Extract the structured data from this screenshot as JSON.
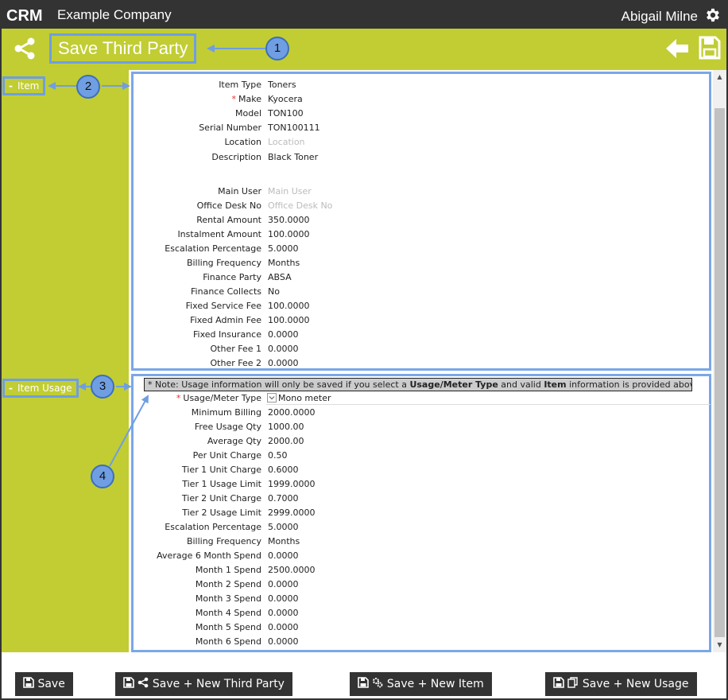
{
  "topbar": {
    "logo_text": "CRM",
    "company": "Example Company",
    "user": "Abigail Milne"
  },
  "header": {
    "title": "Save Third Party"
  },
  "sections": {
    "item": "Item",
    "usage": "Item Usage"
  },
  "annotations": [
    "1",
    "2",
    "3",
    "4"
  ],
  "item_fields": [
    {
      "label": "Item Type",
      "value": "Toners"
    },
    {
      "label": "Make",
      "value": "Kyocera",
      "required": true
    },
    {
      "label": "Model",
      "value": "TON100"
    },
    {
      "label": "Serial Number",
      "value": "TON100111"
    },
    {
      "label": "Location",
      "placeholder": "Location"
    },
    {
      "label": "Description",
      "value": "Black Toner"
    },
    {
      "label": "Main User",
      "placeholder": "Main User"
    },
    {
      "label": "Office Desk No",
      "placeholder": "Office Desk No"
    },
    {
      "label": "Rental Amount",
      "value": "350.0000"
    },
    {
      "label": "Instalment Amount",
      "value": "100.0000"
    },
    {
      "label": "Escalation Percentage",
      "value": "5.0000"
    },
    {
      "label": "Billing Frequency",
      "value": "Months"
    },
    {
      "label": "Finance Party",
      "value": "ABSA"
    },
    {
      "label": "Finance Collects",
      "value": "No"
    },
    {
      "label": "Fixed Service Fee",
      "value": "100.0000"
    },
    {
      "label": "Fixed Admin Fee",
      "value": "100.0000"
    },
    {
      "label": "Fixed Insurance",
      "value": "0.0000"
    },
    {
      "label": "Other Fee 1",
      "value": "0.0000"
    },
    {
      "label": "Other Fee 2",
      "value": "0.0000"
    }
  ],
  "note": {
    "prefix": "* Note: Usage information will only be saved if you select a ",
    "bold1": "Usage/Meter Type",
    "mid": " and valid ",
    "bold2": "Item",
    "suffix": " information is provided above"
  },
  "usage_type": {
    "label": "Usage/Meter Type",
    "value": "Mono meter"
  },
  "usage_fields": [
    {
      "label": "Minimum Billing",
      "value": "2000.0000"
    },
    {
      "label": "Free Usage Qty",
      "value": "1000.00"
    },
    {
      "label": "Average Qty",
      "value": "2000.00"
    },
    {
      "label": "Per Unit Charge",
      "value": "0.50"
    },
    {
      "label": "Tier 1 Unit Charge",
      "value": "0.6000"
    },
    {
      "label": "Tier 1 Usage Limit",
      "value": "1999.0000"
    },
    {
      "label": "Tier 2 Unit Charge",
      "value": "0.7000"
    },
    {
      "label": "Tier 2 Usage Limit",
      "value": "2999.0000"
    },
    {
      "label": "Escalation Percentage",
      "value": "5.0000"
    },
    {
      "label": "Billing Frequency",
      "value": "Months"
    },
    {
      "label": "Average 6 Month Spend",
      "value": "0.0000"
    },
    {
      "label": "Month 1 Spend",
      "value": "2500.0000"
    },
    {
      "label": "Month 2 Spend",
      "value": "0.0000"
    },
    {
      "label": "Month 3 Spend",
      "value": "0.0000"
    },
    {
      "label": "Month 4 Spend",
      "value": "0.0000"
    },
    {
      "label": "Month 5 Spend",
      "value": "0.0000"
    },
    {
      "label": "Month 6 Spend",
      "value": "0.0000"
    }
  ],
  "buttons": {
    "save": "Save",
    "save_new_third_party": "Save + New Third Party",
    "save_new_item": "Save + New Item",
    "save_new_usage": "Save + New Usage"
  },
  "colors": {
    "topbar": "#333333",
    "accent_green": "#c1cd33",
    "annotation_blue": "#6f9ee3"
  }
}
